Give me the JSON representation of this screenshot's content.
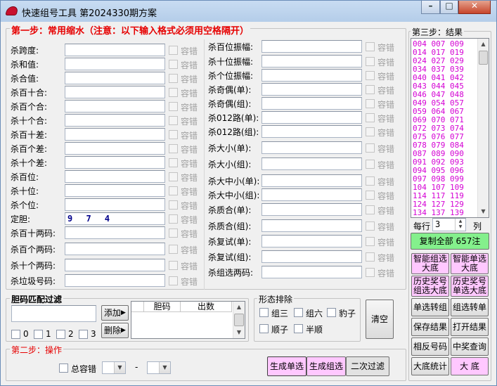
{
  "window": {
    "title": "快速组号工具   第2024330期方案",
    "buttons": {
      "minimize": "–",
      "maximize": "□",
      "close": "✕"
    },
    "icon": "app-logo-icon"
  },
  "step1": {
    "title": "第一步：常用缩水（注意：以下输入格式必须用空格隔开）",
    "tolerance_label": "容错",
    "left_fields": [
      {
        "label": "杀跨度:",
        "value": ""
      },
      {
        "label": "杀和值:",
        "value": ""
      },
      {
        "label": "杀合值:",
        "value": ""
      },
      {
        "label": "杀百十合:",
        "value": ""
      },
      {
        "label": "杀百个合:",
        "value": ""
      },
      {
        "label": "杀十个合:",
        "value": ""
      },
      {
        "label": "杀百十差:",
        "value": ""
      },
      {
        "label": "杀百个差:",
        "value": ""
      },
      {
        "label": "杀十个差:",
        "value": ""
      },
      {
        "label": "杀百位:",
        "value": ""
      },
      {
        "label": "杀十位:",
        "value": ""
      },
      {
        "label": "杀个位:",
        "value": ""
      },
      {
        "label": "定胆:",
        "value": "9 7 4"
      },
      {
        "label": "杀百十两码:",
        "value": ""
      },
      {
        "label": "杀百个两码:",
        "value": ""
      },
      {
        "label": "杀十个两码:",
        "value": ""
      },
      {
        "label": "杀垃圾号码:",
        "value": ""
      }
    ],
    "right_fields": [
      {
        "label": "杀百位振幅:",
        "value": ""
      },
      {
        "label": "杀十位振幅:",
        "value": ""
      },
      {
        "label": "杀个位振幅:",
        "value": ""
      },
      {
        "label": "杀奇偶(单):",
        "value": ""
      },
      {
        "label": "杀奇偶(组):",
        "value": ""
      },
      {
        "label": "杀012路(单):",
        "value": ""
      },
      {
        "label": "杀012路(组):",
        "value": ""
      },
      {
        "label": "杀大小(单):",
        "value": ""
      },
      {
        "label": "杀大小(组):",
        "value": ""
      },
      {
        "label": "杀大中小(单):",
        "value": ""
      },
      {
        "label": "杀大中小(组):",
        "value": ""
      },
      {
        "label": "杀质合(单):",
        "value": ""
      },
      {
        "label": "杀质合(组):",
        "value": ""
      },
      {
        "label": "杀复试(单):",
        "value": ""
      },
      {
        "label": "杀复试(组):",
        "value": ""
      },
      {
        "label": "杀组选两码:",
        "value": ""
      }
    ]
  },
  "dan_filter": {
    "title": "胆码匹配过滤",
    "input_value": "",
    "add_label": "添加",
    "delete_label": "删除",
    "columns": [
      "胆码",
      "出数"
    ],
    "count_checks": [
      "0",
      "1",
      "2",
      "3"
    ]
  },
  "shape_filter": {
    "title": "形态排除",
    "options": [
      "组三",
      "组六",
      "豹子",
      "顺子",
      "半顺"
    ],
    "clear_label": "清空"
  },
  "step2": {
    "title": "第二步：操作",
    "total_tolerance_label": "总容错",
    "dash": "-",
    "buttons": [
      "生成单选",
      "生成组选",
      "二次过滤"
    ]
  },
  "step3": {
    "title": "第三步：结果",
    "results": [
      "004 007 009",
      "014 017 019",
      "024 027 029",
      "034 037 039",
      "040 041 042",
      "043 044 045",
      "046 047 048",
      "049 054 057",
      "059 064 067",
      "069 070 071",
      "072 073 074",
      "075 076 077",
      "078 079 084",
      "087 089 090",
      "091 092 093",
      "094 095 096",
      "097 098 099",
      "104 107 109",
      "114 117 119",
      "124 127 129",
      "134 137 139"
    ],
    "per_row_label": "每行",
    "per_row_value": "3",
    "col_label": "列",
    "copy_label": "复制全部 657注",
    "buttons": [
      [
        "智能组选\n大底",
        "智能单选\n大底"
      ],
      [
        "历史奖号\n组选大底",
        "历史奖号\n单选大底"
      ],
      [
        "单选转组",
        "组选转单"
      ],
      [
        "保存结果",
        "打开结果"
      ],
      [
        "相反号码",
        "中奖查询"
      ],
      [
        "大底统计",
        "大  底"
      ]
    ]
  }
}
